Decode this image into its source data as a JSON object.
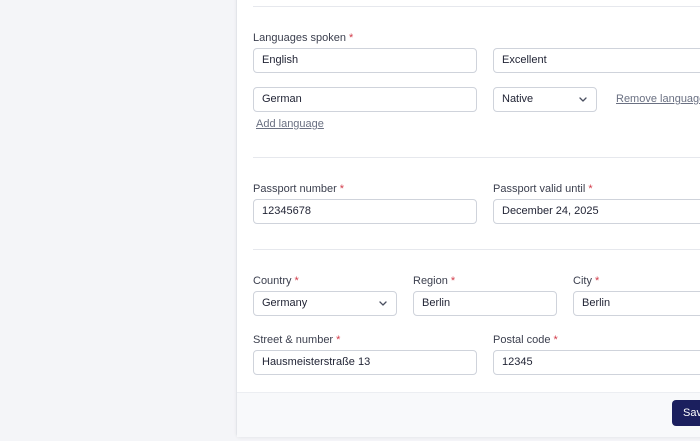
{
  "languages": {
    "label": "Languages spoken",
    "required": "*",
    "rows": [
      {
        "language": "English",
        "level": "Excellent"
      },
      {
        "language": "German",
        "level": "Native",
        "remove_label": "Remove language"
      }
    ],
    "add_label": "Add language"
  },
  "passport": {
    "number_label": "Passport number",
    "number_value": "12345678",
    "valid_label": "Passport valid until",
    "valid_value": "December 24, 2025",
    "required": "*"
  },
  "address": {
    "country_label": "Country",
    "country_value": "Germany",
    "region_label": "Region",
    "region_value": "Berlin",
    "city_label": "City",
    "city_value": "Berlin",
    "street_label": "Street & number",
    "street_value": "Hausmeisterstraße 13",
    "postal_label": "Postal code",
    "postal_value": "12345",
    "required": "*"
  },
  "footer": {
    "save_label": "Save"
  },
  "colors": {
    "primary_button": "#1b1f5e",
    "required_marker": "#d23c4a",
    "page_bg": "#f4f5f8"
  }
}
